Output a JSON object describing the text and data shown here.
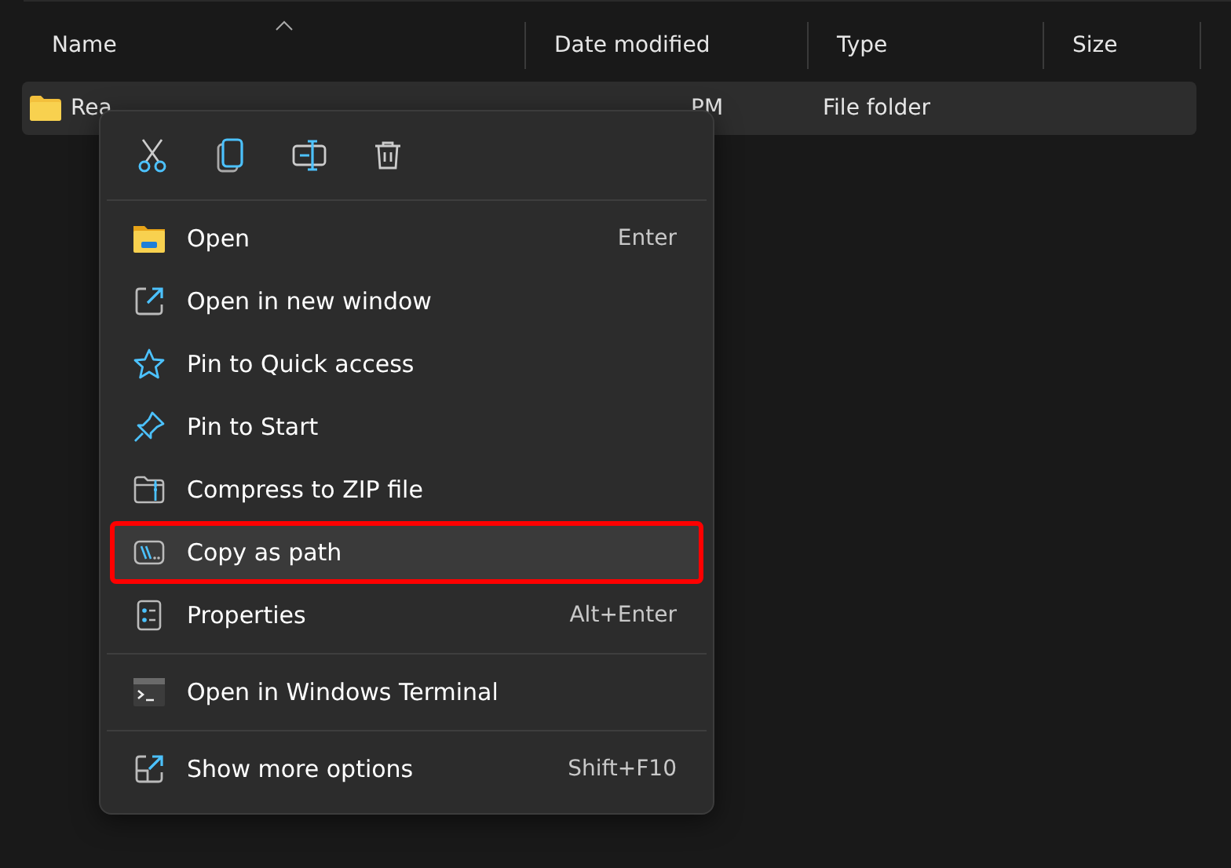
{
  "columns": [
    {
      "label": "Name",
      "sort_ascending": true
    },
    {
      "label": "Date modified"
    },
    {
      "label": "Type"
    },
    {
      "label": "Size"
    }
  ],
  "rows": [
    {
      "name": "Rea",
      "date": "PM",
      "type": "File folder",
      "selected": true
    }
  ],
  "context_menu": {
    "actions": [
      {
        "kind": "cut"
      },
      {
        "kind": "copy"
      },
      {
        "kind": "rename"
      },
      {
        "kind": "delete"
      }
    ],
    "groups": [
      [
        {
          "kind": "folder",
          "label": "Open",
          "shortcut": "Enter",
          "selected": false
        },
        {
          "kind": "newwindow",
          "label": "Open in new window",
          "selected": false
        },
        {
          "kind": "star",
          "label": "Pin to Quick access",
          "selected": false
        },
        {
          "kind": "pin",
          "label": "Pin to Start",
          "selected": false
        },
        {
          "kind": "zip",
          "label": "Compress to ZIP file",
          "selected": false
        },
        {
          "kind": "path",
          "label": "Copy as path",
          "selected": true
        },
        {
          "kind": "props",
          "label": "Properties",
          "shortcut": "Alt+Enter",
          "selected": false
        }
      ],
      [
        {
          "kind": "terminal",
          "label": "Open in Windows Terminal",
          "selected": false
        }
      ],
      [
        {
          "kind": "more",
          "label": "Show more options",
          "shortcut": "Shift+F10",
          "selected": false
        }
      ]
    ]
  }
}
